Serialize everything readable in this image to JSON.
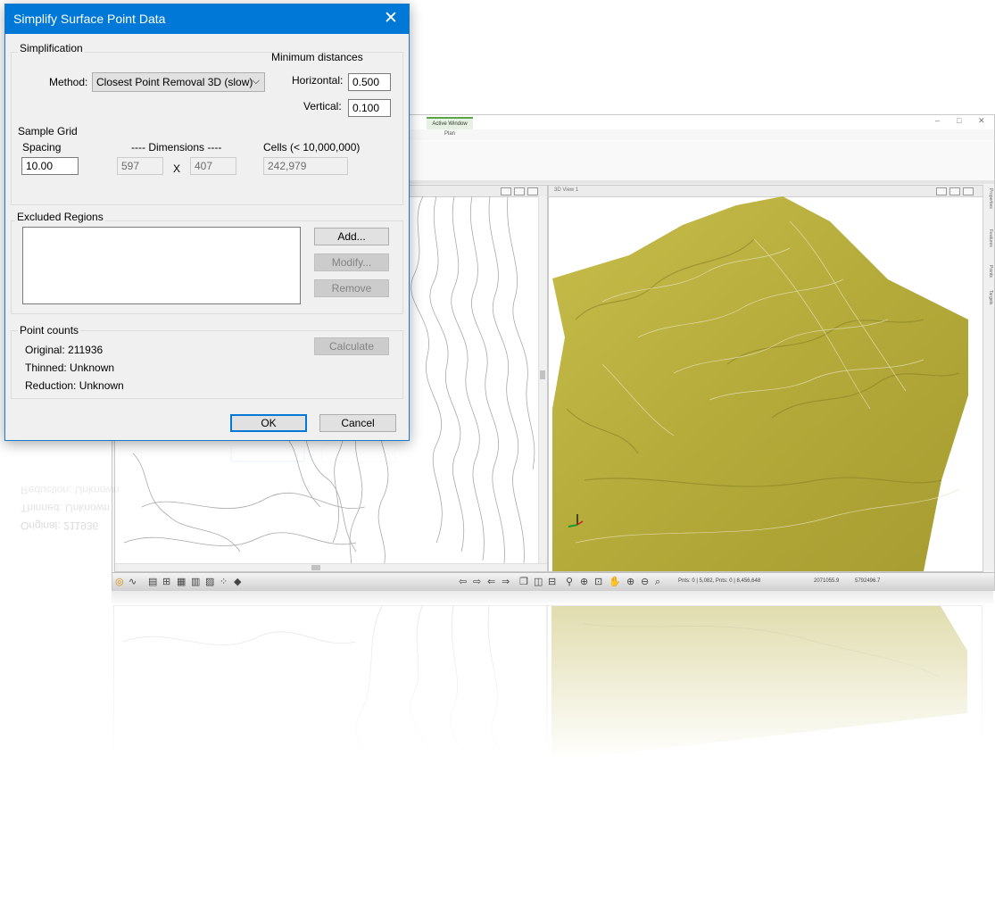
{
  "dialog": {
    "title": "Simplify Surface Point Data",
    "close_icon": "✕",
    "simplification": {
      "group_label": "Simplification",
      "method_label": "Method:",
      "method_value": "Closest Point Removal 3D (slow)",
      "min_distances_label": "Minimum distances",
      "horizontal_label": "Horizontal:",
      "horizontal_value": "0.500",
      "vertical_label": "Vertical:",
      "vertical_value": "0.100"
    },
    "sample_grid": {
      "group_label": "Sample Grid",
      "spacing_label": "Spacing",
      "spacing_value": "10.00",
      "dimensions_label": "---- Dimensions ----",
      "dim_x": "597",
      "x_label": "X",
      "dim_y": "407",
      "cells_label": "Cells (< 10,000,000)",
      "cells_value": "242,979"
    },
    "excluded_regions": {
      "group_label": "Excluded Regions",
      "add_label": "Add...",
      "modify_label": "Modify...",
      "remove_label": "Remove"
    },
    "point_counts": {
      "group_label": "Point counts",
      "original": "Original: 211936",
      "thinned": "Thinned: Unknown",
      "reduction": "Reduction: Unknown",
      "calculate_label": "Calculate"
    },
    "ok_label": "OK",
    "cancel_label": "Cancel"
  },
  "app": {
    "active_tab": "Active Window",
    "menu_item_1": "Plan",
    "view3d_title": "3D View 1",
    "side_tabs": [
      "Properties",
      "Features",
      "Points",
      "Targets"
    ],
    "status_counts": "Pnts: 0 | 5,082, Pnts: 0 | 8,456,648",
    "status_x": "2071055.9",
    "status_y": "5792496.7"
  },
  "colors": {
    "titlebar": "#0078d7",
    "terrain": "#b7ad3e",
    "contour": "#9a9a9a"
  }
}
